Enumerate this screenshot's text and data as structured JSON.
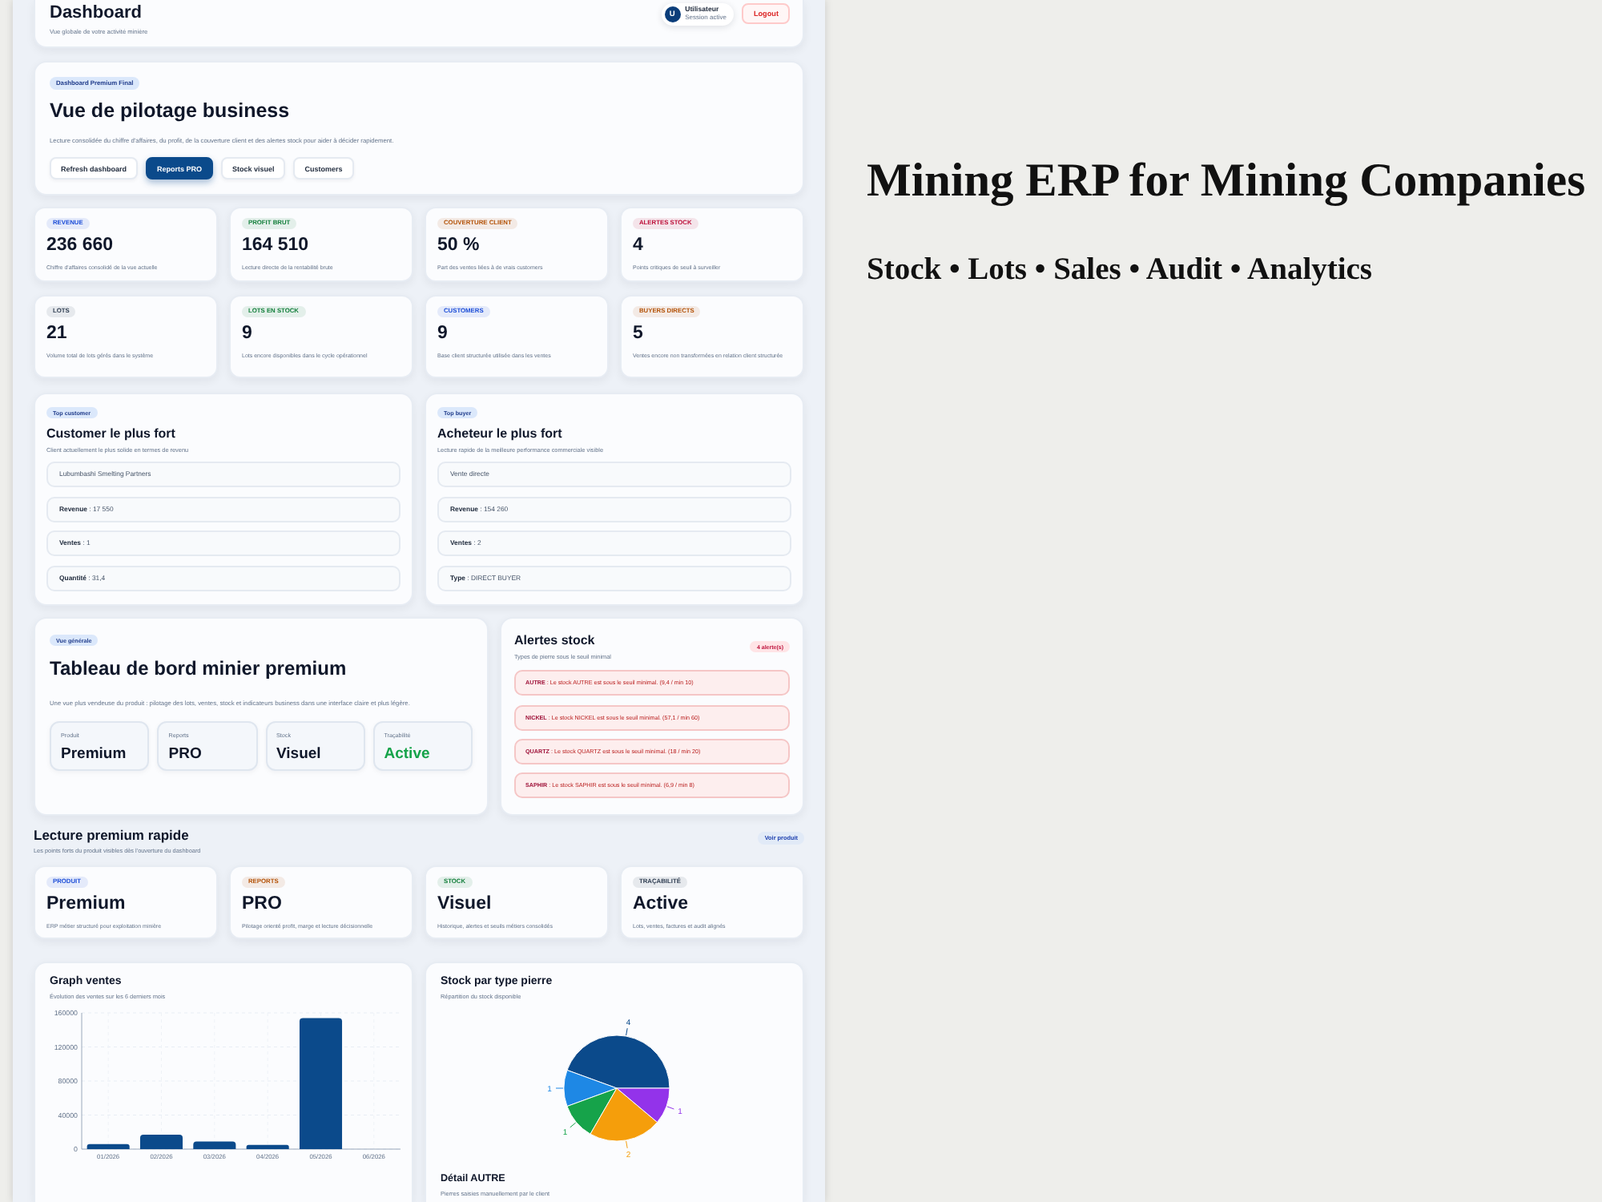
{
  "header": {
    "title": "Dashboard",
    "subtitle": "Vue globale de votre activité minière",
    "user": {
      "initial": "U",
      "name": "Utilisateur",
      "status": "Session active"
    },
    "logout": "Logout"
  },
  "hero": {
    "badge": "Dashboard Premium Final",
    "title": "Vue de pilotage business",
    "description": "Lecture consolidée du chiffre d'affaires, du profit, de la couverture client et des alertes stock pour aider à décider rapidement.",
    "buttons": [
      {
        "label": "Refresh dashboard",
        "kind": "secondary"
      },
      {
        "label": "Reports PRO",
        "kind": "primary"
      },
      {
        "label": "Stock visuel",
        "kind": "secondary"
      },
      {
        "label": "Customers",
        "kind": "secondary"
      }
    ]
  },
  "kpis": [
    {
      "label": "REVENUE",
      "value": "236 660",
      "description": "Chiffre d'affaires consolidé de la vue actuelle",
      "color": "#1d4ed8"
    },
    {
      "label": "PROFIT BRUT",
      "value": "164 510",
      "description": "Lecture directe de la rentabilité brute",
      "color": "#15803d"
    },
    {
      "label": "COUVERTURE CLIENT",
      "value": "50 %",
      "description": "Part des ventes liées à de vrais customers",
      "color": "#b45309"
    },
    {
      "label": "ALERTES STOCK",
      "value": "4",
      "description": "Points critiques de seuil à surveiller",
      "color": "#be123c"
    },
    {
      "label": "LOTS",
      "value": "21",
      "description": "Volume total de lots gérés dans le système",
      "color": "#334155"
    },
    {
      "label": "LOTS EN STOCK",
      "value": "9",
      "description": "Lots encore disponibles dans le cycle opérationnel",
      "color": "#15803d"
    },
    {
      "label": "CUSTOMERS",
      "value": "9",
      "description": "Base client structurée utilisée dans les ventes",
      "color": "#1d4ed8"
    },
    {
      "label": "BUYERS DIRECTS",
      "value": "5",
      "description": "Ventes encore non transformées en relation client structurée",
      "color": "#b45309"
    }
  ],
  "highlights": [
    {
      "badge": "Top customer",
      "title": "Customer le plus fort",
      "subtitle": "Client actuellement le plus solide en termes de revenu",
      "rows": [
        "Lubumbashi Smelting Partners",
        "**Revenue** : 17 550",
        "**Ventes** : 1",
        "**Quantité** : 31,4"
      ]
    },
    {
      "badge": "Top buyer",
      "title": "Acheteur le plus fort",
      "subtitle": "Lecture rapide de la meilleure performance commerciale visible",
      "rows": [
        "Vente directe",
        "**Revenue** : 154 260",
        "**Ventes** : 2",
        "**Type** : DIRECT BUYER"
      ]
    }
  ],
  "overview": {
    "badge": "Vue générale",
    "title": "Tableau de bord minier premium",
    "description": "Une vue plus vendeuse du produit : pilotage des lots, ventes, stock et indicateurs business dans une interface claire et plus légère.",
    "stats": [
      {
        "label": "Produit",
        "value": "Premium",
        "color": "#0f172a"
      },
      {
        "label": "Reports",
        "value": "PRO",
        "color": "#0f172a"
      },
      {
        "label": "Stock",
        "value": "Visuel",
        "color": "#0f172a"
      },
      {
        "label": "Traçabilité",
        "value": "Active",
        "color": "#16a34a"
      }
    ]
  },
  "alerts": {
    "title": "Alertes stock",
    "subtitle": "Types de pierre sous le seuil minimal",
    "count": "4 alerte(s)",
    "items": [
      "**AUTRE** : Le stock AUTRE est sous le seuil minimal. (9,4 / min 10)",
      "**NICKEL** : Le stock NICKEL est sous le seuil minimal. (57,1 / min 60)",
      "**QUARTZ** : Le stock QUARTZ est sous le seuil minimal. (18 / min 20)",
      "**SAPHIR** : Le stock SAPHIR est sous le seuil minimal. (6,9 / min 8)"
    ]
  },
  "quick": {
    "title": "Lecture premium rapide",
    "subtitle": "Les points forts du produit visibles dès l'ouverture du dashboard",
    "action": "Voir produit",
    "cards": [
      {
        "label": "PRODUIT",
        "value": "Premium",
        "description": "ERP métier structuré pour exploitation minière",
        "color": "#1d4ed8"
      },
      {
        "label": "REPORTS",
        "value": "PRO",
        "description": "Pilotage orienté profit, marge et lecture décisionnelle",
        "color": "#b45309"
      },
      {
        "label": "STOCK",
        "value": "Visuel",
        "description": "Historique, alertes et seuils métiers consolidés",
        "color": "#15803d"
      },
      {
        "label": "TRAÇABILITÉ",
        "value": "Active",
        "description": "Lots, ventes, factures et audit alignés",
        "color": "#334155"
      }
    ]
  },
  "sales_chart": {
    "chart_data": [
      {
        "type": "bar",
        "title": "Graph ventes",
        "subtitle": "Évolution des ventes sur les 6 derniers mois",
        "categories": [
          "01/2026",
          "02/2026",
          "03/2026",
          "04/2026",
          "05/2026",
          "06/2026"
        ],
        "values": [
          6000,
          17000,
          9000,
          5000,
          154000,
          0
        ],
        "color": "#0b4a8b",
        "ylim": [
          0,
          160000
        ],
        "yticks": [
          0,
          40000,
          80000,
          120000,
          160000
        ],
        "grid": true
      }
    ]
  },
  "stock_chart": {
    "chart_data": [
      {
        "type": "pie",
        "title": "Stock par type pierre",
        "subtitle": "Répartition du stock disponible",
        "values": [
          4,
          1,
          1,
          2,
          1
        ],
        "colors": [
          "#0b4a8b",
          "#1e88e5",
          "#16a34a",
          "#f59e0b",
          "#9333ea"
        ],
        "data_labels": true
      }
    ],
    "detail": {
      "title": "Détail AUTRE",
      "subtitle": "Pierres saisies manuellement par le client"
    }
  },
  "promo": {
    "title": "Mining ERP for Mining Companies",
    "tagline": "Stock • Lots • Sales • Audit • Analytics"
  }
}
